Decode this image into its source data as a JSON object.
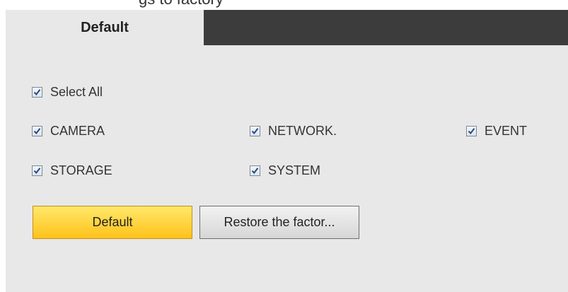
{
  "top_strip": {
    "partial_text": "gs to factory"
  },
  "tabs": {
    "active_label": "Default"
  },
  "options": {
    "select_all": {
      "label": "Select All",
      "checked": true
    },
    "camera": {
      "label": "CAMERA",
      "checked": true
    },
    "network": {
      "label": "NETWORK.",
      "checked": true
    },
    "event": {
      "label": "EVENT",
      "checked": true
    },
    "storage": {
      "label": "STORAGE",
      "checked": true
    },
    "system": {
      "label": "SYSTEM",
      "checked": true
    }
  },
  "buttons": {
    "default_label": "Default",
    "restore_label": "Restore the factor..."
  },
  "colors": {
    "panel_bg": "#e8e8e8",
    "tabbar_bg": "#3c3c3c",
    "default_button": "#ffc21a",
    "checkmark": "#1f4a8a"
  },
  "icons": {
    "checkbox": "checkbox-checked-icon"
  }
}
